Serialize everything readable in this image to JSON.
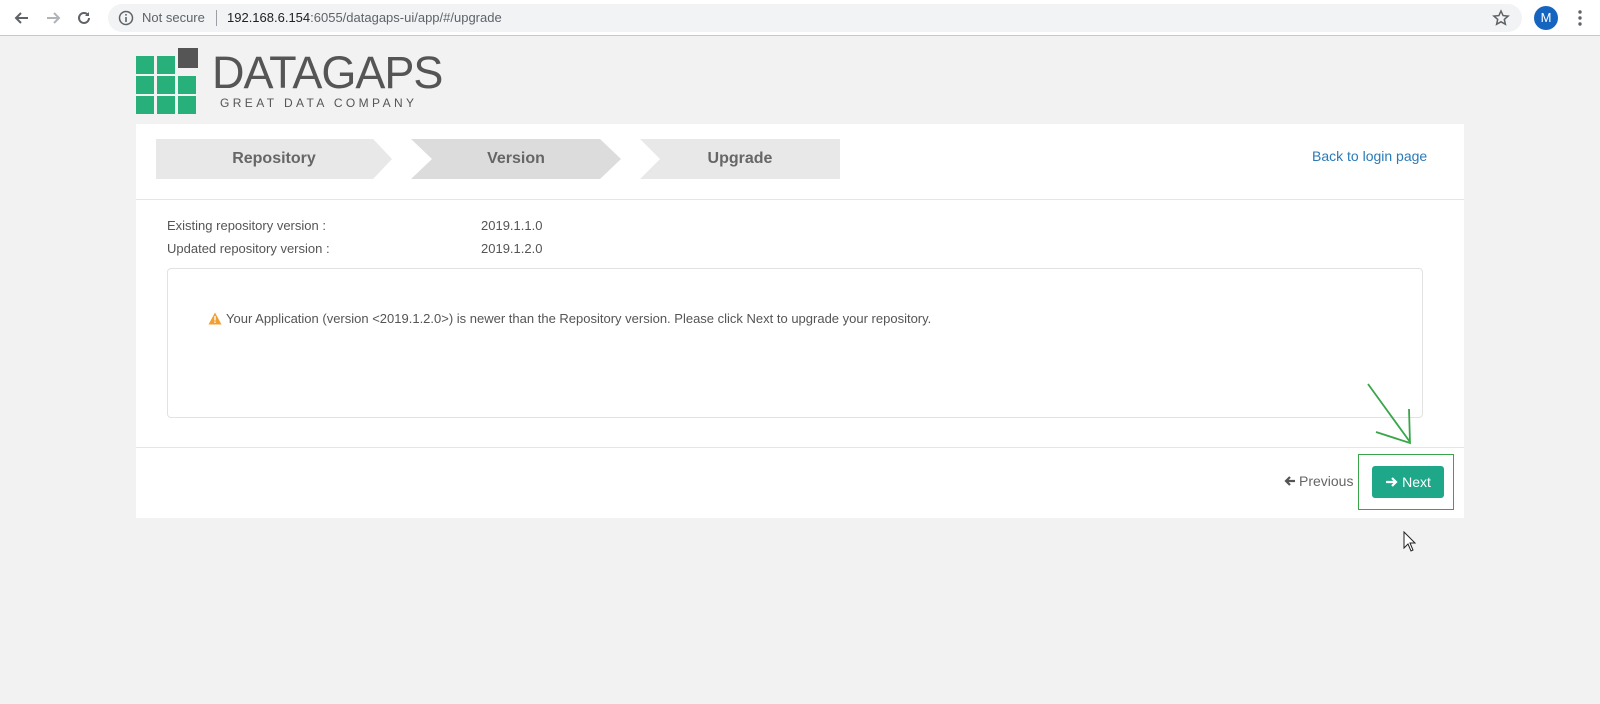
{
  "browser": {
    "security_label": "Not secure",
    "url_host": "192.168.6.154",
    "url_path": ":6055/datagaps-ui/app/#/upgrade",
    "profile_initial": "M"
  },
  "logo": {
    "wordmark": "DATAGAPS",
    "tagline": "GREAT DATA COMPANY"
  },
  "steps": [
    "Repository",
    "Version",
    "Upgrade"
  ],
  "back_link": "Back to login page",
  "versions": {
    "existing_label": "Existing repository version :",
    "existing_value": "2019.1.1.0",
    "updated_label": "Updated repository version :",
    "updated_value": "2019.1.2.0"
  },
  "message": "Your Application (version <2019.1.2.0>) is newer than the Repository version. Please click Next to upgrade your repository.",
  "footer": {
    "previous_label": "Previous",
    "next_label": "Next"
  },
  "colors": {
    "brand_green": "#27b07a",
    "next_button": "#1ea789",
    "link_blue": "#2a7ab8",
    "warning": "#f0a030",
    "annotation_green": "#3aa64a"
  }
}
